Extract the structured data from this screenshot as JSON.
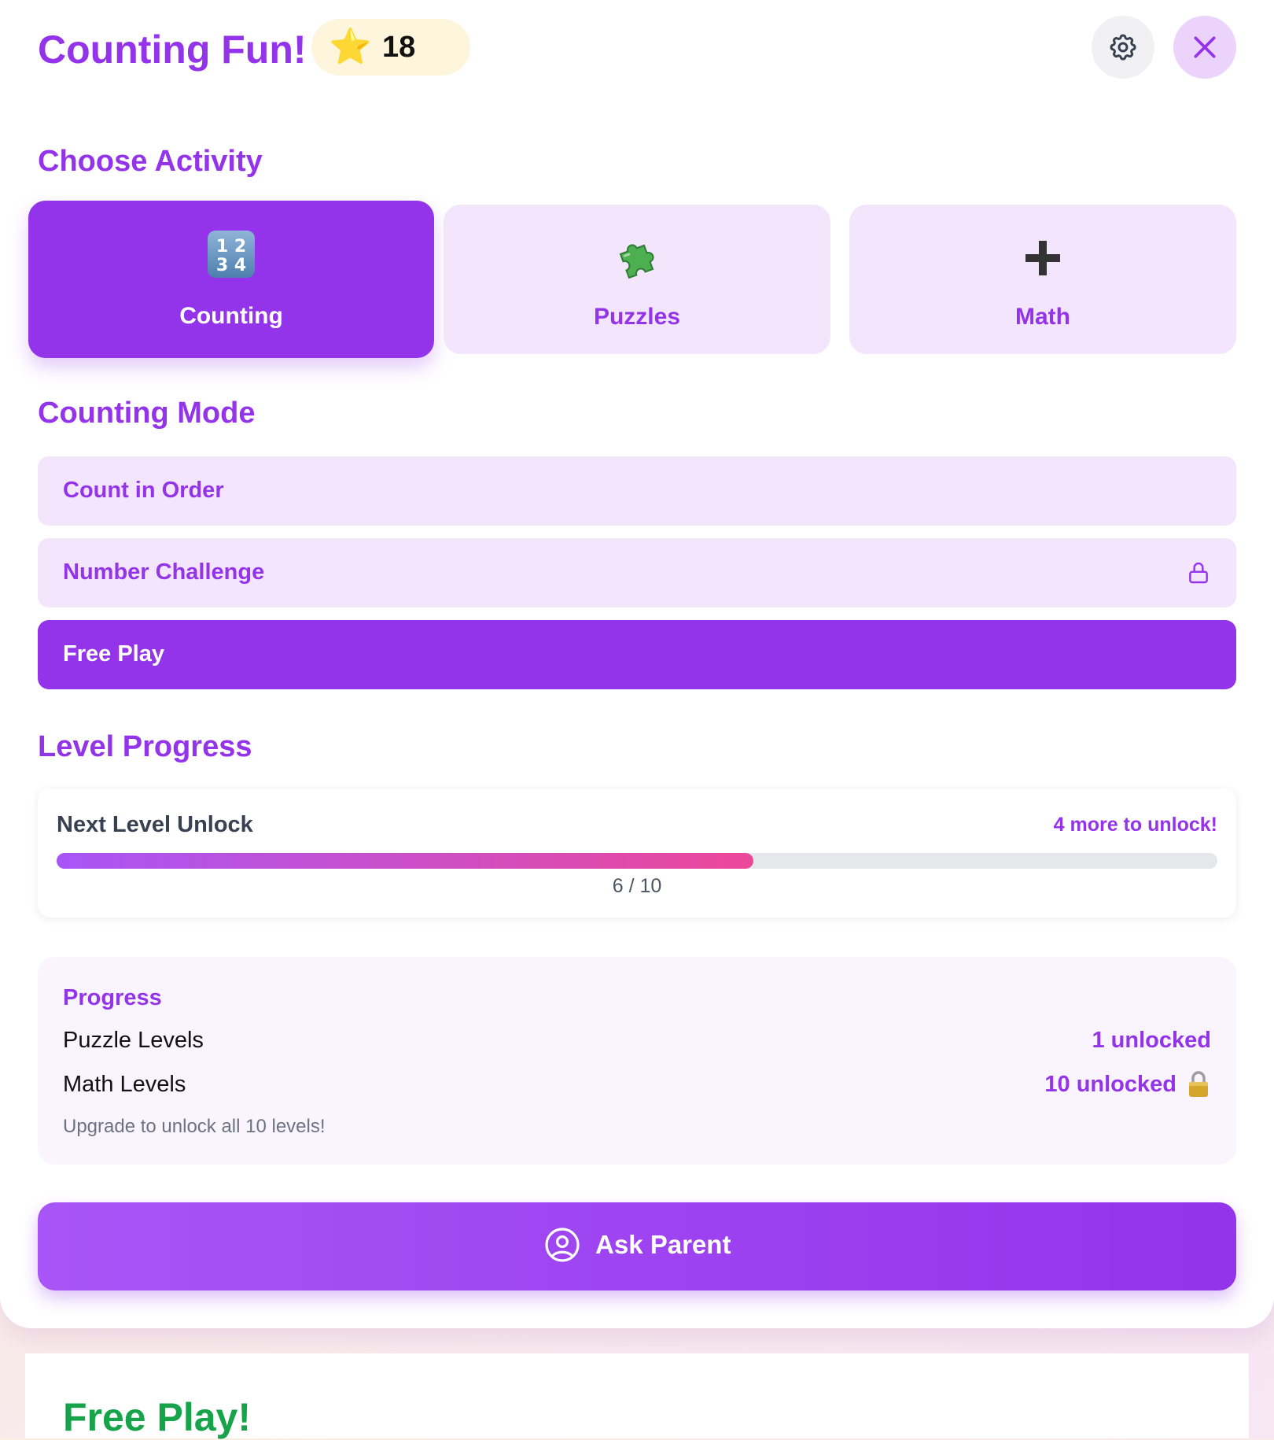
{
  "header": {
    "title": "Counting Fun!",
    "stars": "18",
    "star_icon": "star-icon",
    "settings_icon": "gear-icon",
    "close_icon": "close-icon"
  },
  "activity": {
    "title": "Choose Activity",
    "items": [
      {
        "label": "Counting",
        "icon": "keycap-1234-icon",
        "selected": true
      },
      {
        "label": "Puzzles",
        "icon": "puzzle-piece-icon",
        "selected": false
      },
      {
        "label": "Math",
        "icon": "plus-icon",
        "selected": false
      }
    ]
  },
  "mode": {
    "title": "Counting Mode",
    "items": [
      {
        "label": "Count in Order",
        "locked": false,
        "active": false
      },
      {
        "label": "Number Challenge",
        "locked": true,
        "active": false
      },
      {
        "label": "Free Play",
        "locked": false,
        "active": true
      }
    ]
  },
  "level": {
    "title": "Level Progress",
    "card_label": "Next Level Unlock",
    "hint": "4 more to unlock!",
    "current": 6,
    "total": 10,
    "fraction_text": "6 / 10"
  },
  "progress": {
    "title": "Progress",
    "rows": [
      {
        "label": "Puzzle Levels",
        "value": "1 unlocked"
      },
      {
        "label": "Math Levels",
        "value": "10 unlocked"
      }
    ],
    "note": "Upgrade to unlock all 10 levels!"
  },
  "ask_parent": {
    "label": "Ask Parent",
    "icon": "user-circle-icon"
  },
  "free_play": {
    "title": "Free Play!"
  },
  "colors": {
    "accent": "#9333ea",
    "accent_light": "#f3e6fc",
    "success": "#16a34a",
    "progress_start": "#a855f7",
    "progress_end": "#ec4899"
  }
}
